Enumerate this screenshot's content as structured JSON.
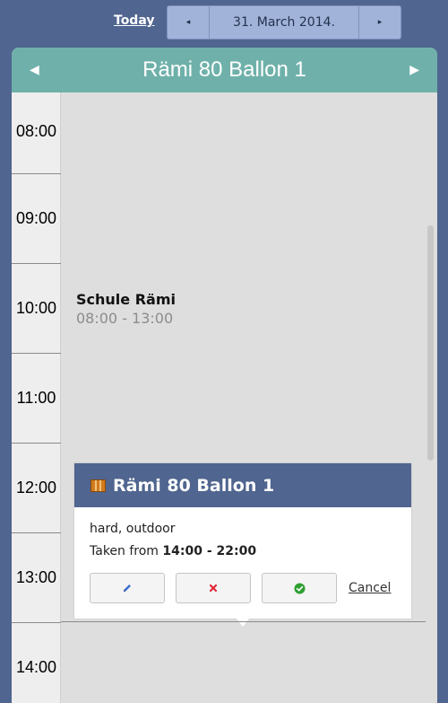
{
  "topbar": {
    "today_label": "Today",
    "prev_icon": "chevron-left-icon",
    "next_icon": "chevron-right-icon",
    "date": "31. March 2014."
  },
  "calendar": {
    "title": "Rämi 80 Ballon 1",
    "hours": [
      "08:00",
      "09:00",
      "10:00",
      "11:00",
      "12:00",
      "13:00",
      "14:00"
    ],
    "event": {
      "title": "Schule Rämi",
      "time": "08:00 - 13:00"
    }
  },
  "popup": {
    "title": "Rämi 80 Ballon 1",
    "surface": "hard, outdoor",
    "taken_prefix": "Taken from",
    "taken_range": "14:00 - 22:00",
    "cancel_label": "Cancel",
    "edit_icon": "pencil-icon",
    "delete_icon": "close-icon",
    "confirm_icon": "check-circle-icon"
  },
  "colors": {
    "background": "#50658f",
    "header": "#6fb1aa",
    "date_bar": "#a1b3d9",
    "popup_header": "#50658f"
  }
}
